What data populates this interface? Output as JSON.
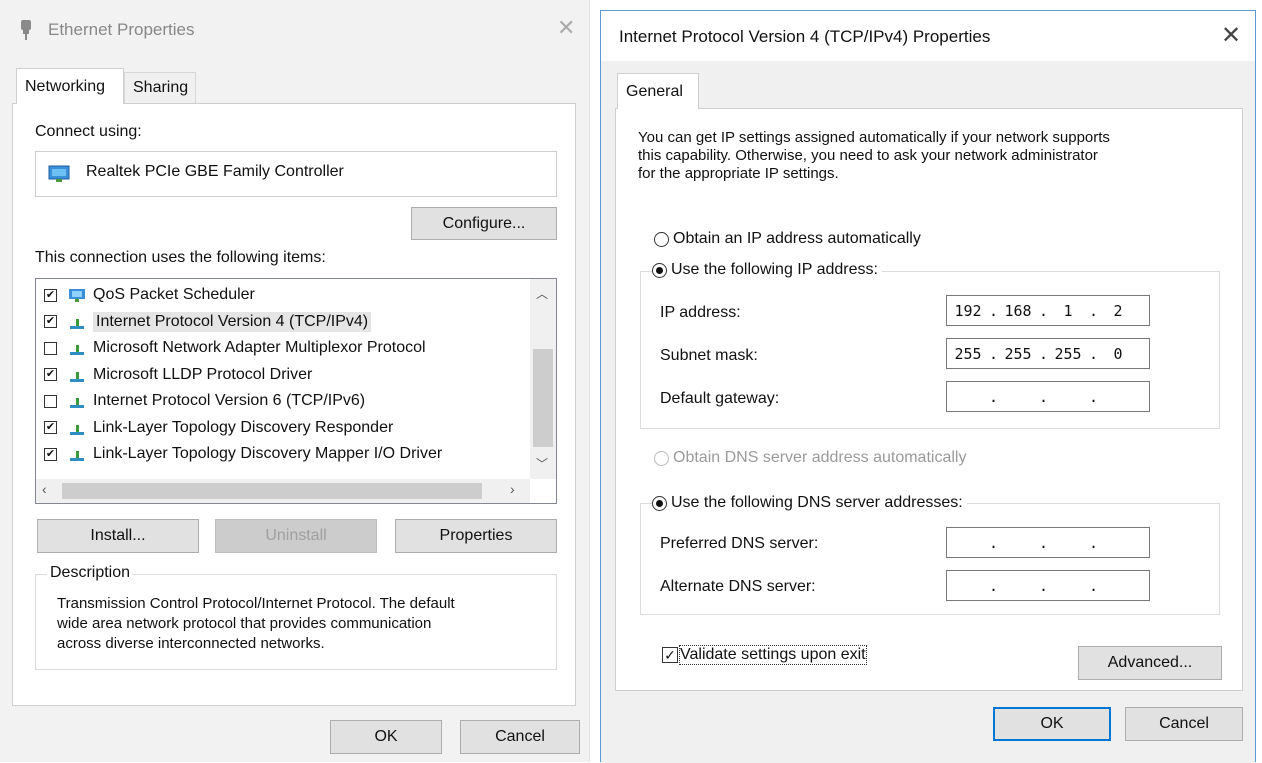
{
  "left_window": {
    "title": "Ethernet Properties",
    "tabs": [
      "Networking",
      "Sharing"
    ],
    "connect_using_label": "Connect using:",
    "adapter_name": "Realtek PCIe GBE Family Controller",
    "configure_button": "Configure...",
    "items_label": "This connection uses the following items:",
    "items": [
      {
        "label": "QoS Packet Scheduler",
        "checked": true,
        "icon": "qos-icon"
      },
      {
        "label": "Internet Protocol Version 4 (TCP/IPv4)",
        "checked": true,
        "icon": "protocol-icon",
        "selected": true
      },
      {
        "label": "Microsoft Network Adapter Multiplexor Protocol",
        "checked": false,
        "icon": "protocol-icon"
      },
      {
        "label": "Microsoft LLDP Protocol Driver",
        "checked": true,
        "icon": "protocol-icon"
      },
      {
        "label": "Internet Protocol Version 6 (TCP/IPv6)",
        "checked": false,
        "icon": "protocol-icon"
      },
      {
        "label": "Link-Layer Topology Discovery Responder",
        "checked": true,
        "icon": "protocol-icon"
      },
      {
        "label": "Link-Layer Topology Discovery Mapper I/O Driver",
        "checked": true,
        "icon": "protocol-icon"
      }
    ],
    "install_button": "Install...",
    "uninstall_button": "Uninstall",
    "properties_button": "Properties",
    "description_label": "Description",
    "description_lines": [
      "Transmission Control Protocol/Internet Protocol. The default",
      "wide area network protocol that provides communication",
      "across diverse interconnected networks."
    ],
    "ok_button": "OK",
    "cancel_button": "Cancel"
  },
  "right_window": {
    "title": "Internet Protocol Version 4 (TCP/IPv4) Properties",
    "tab": "General",
    "intro_lines": [
      "You can get IP settings assigned automatically if your network supports",
      "this capability. Otherwise, you need to ask your network administrator",
      "for the appropriate IP settings."
    ],
    "radio_obtain_ip": "Obtain an IP address automatically",
    "radio_use_ip": "Use the following IP address:",
    "ip_label": "IP address:",
    "ip_octets": [
      "192",
      "168",
      "1",
      "2"
    ],
    "subnet_label": "Subnet mask:",
    "subnet_octets": [
      "255",
      "255",
      "255",
      "0"
    ],
    "gateway_label": "Default gateway:",
    "radio_obtain_dns": "Obtain DNS server address automatically",
    "radio_use_dns": "Use the following DNS server addresses:",
    "preferred_dns_label": "Preferred DNS server:",
    "alternate_dns_label": "Alternate DNS server:",
    "validate_label": "Validate settings upon exit",
    "validate_checked": true,
    "advanced_button": "Advanced...",
    "ok_button": "OK",
    "cancel_button": "Cancel"
  }
}
